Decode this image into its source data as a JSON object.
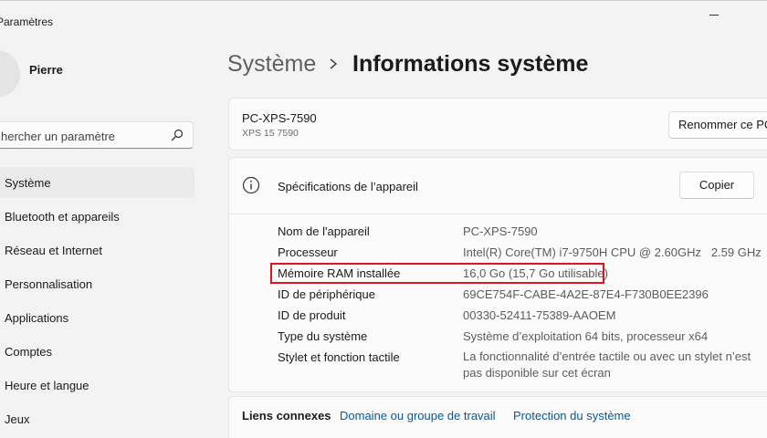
{
  "window": {
    "title": "Paramètres"
  },
  "profile": {
    "name": "Pierre"
  },
  "search": {
    "placeholder": "hercher un paramètre"
  },
  "sidebar": {
    "items": [
      {
        "label": "Système",
        "active": true
      },
      {
        "label": "Bluetooth et appareils"
      },
      {
        "label": "Réseau et Internet"
      },
      {
        "label": "Personnalisation"
      },
      {
        "label": "Applications"
      },
      {
        "label": "Comptes"
      },
      {
        "label": "Heure et langue"
      },
      {
        "label": "Jeux"
      }
    ]
  },
  "breadcrumb": {
    "parent": "Système",
    "current": "Informations système"
  },
  "pc": {
    "name": "PC-XPS-7590",
    "model": "XPS 15 7590",
    "rename_label": "Renommer ce PC"
  },
  "specs": {
    "title": "Spécifications de l’appareil",
    "copy_label": "Copier",
    "rows": [
      {
        "label": "Nom de l'appareil",
        "value": "PC-XPS-7590"
      },
      {
        "label": "Processeur",
        "value": "Intel(R) Core(TM) i7-9750H CPU @ 2.60GHz   2.59 GHz"
      },
      {
        "label": "Mémoire RAM installée",
        "value": "16,0 Go (15,7 Go utilisable)"
      },
      {
        "label": "ID de périphérique",
        "value": "69CE754F-CABE-4A2E-87E4-F730B0EE2396"
      },
      {
        "label": "ID de produit",
        "value": "00330-52411-75389-AAOEM"
      },
      {
        "label": "Type du système",
        "value": "Système d’exploitation 64 bits, processeur x64"
      },
      {
        "label": "Stylet et fonction tactile",
        "value": "La fonctionnalité d’entrée tactile ou avec un stylet n’est pas disponible sur cet écran"
      }
    ]
  },
  "links": {
    "label": "Liens connexes",
    "items": [
      "Domaine ou groupe de travail",
      "Protection du système"
    ]
  },
  "colors": {
    "accent": "#005a9e",
    "highlight": "#e0141e"
  }
}
